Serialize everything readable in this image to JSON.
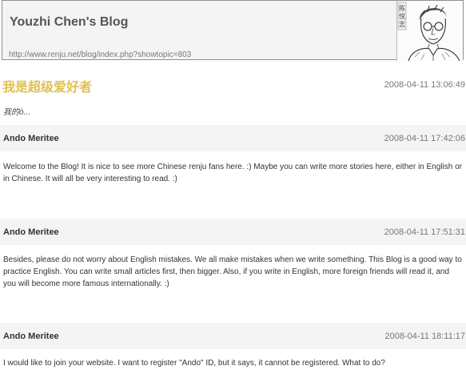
{
  "header": {
    "title": "Youzhi Chen's Blog",
    "url": "http://www.renju.net/blog/index.php?showtopic=803",
    "portrait_caption": "陈悦志"
  },
  "post": {
    "title": "我是超级爱好者",
    "date": "2008-04-11 13:06:49",
    "body": "我的ò..."
  },
  "comments": [
    {
      "author": "Ando Meritee",
      "date": "2008-04-11 17:42:06",
      "text": "Welcome to the Blog! It is nice to see more Chinese renju fans here. :) Maybe you can write more stories here, either in English or in Chinese. It will all be very interesting to read. :)"
    },
    {
      "author": "Ando Meritee",
      "date": "2008-04-11 17:51:31",
      "text": "Besides, please do not worry about English mistakes. We all make mistakes when we write something. This Blog is a good way to practice English. You can write small articles first, then bigger. Also, if you write in English, more foreign friends will read it, and you will become more famous internationally. :)"
    },
    {
      "author": "Ando Meritee",
      "date": "2008-04-11 18:11:17",
      "text": "I would like to join your website. I want to register \"Ando\" ID, but it says, it cannot be registered. What to do?"
    }
  ]
}
